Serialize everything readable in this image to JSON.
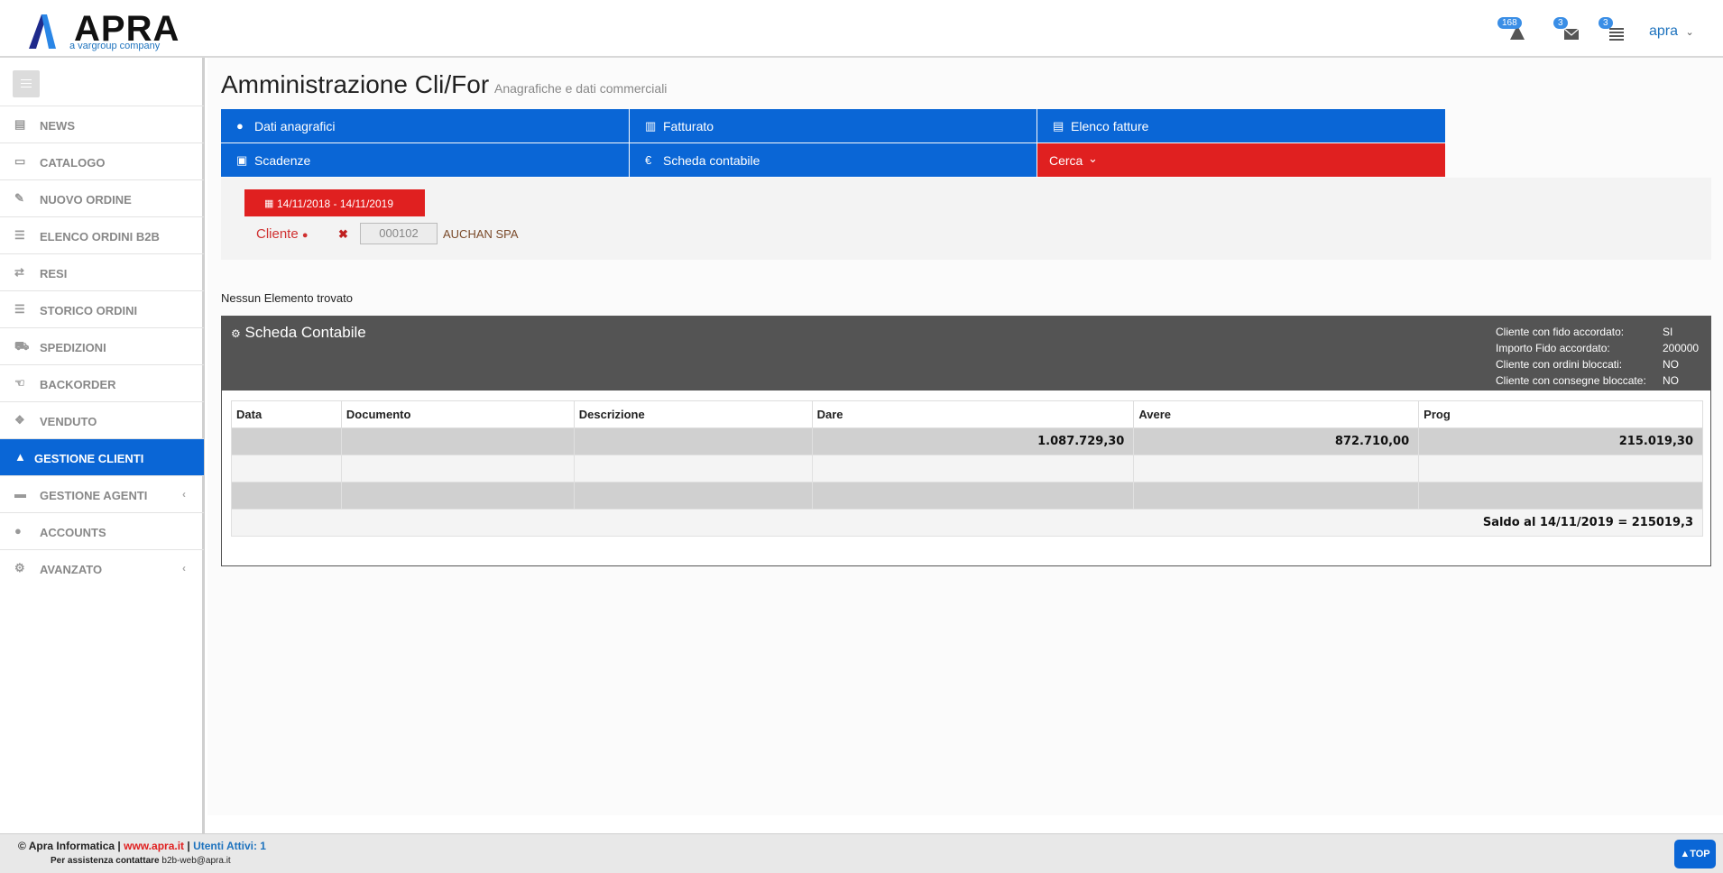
{
  "header": {
    "logo_text": "APRA",
    "logo_sub": "a vargroup company",
    "notifications": [
      {
        "icon": "warning-icon",
        "count": "168"
      },
      {
        "icon": "mail-icon",
        "count": "3"
      },
      {
        "icon": "list-icon",
        "count": "3"
      }
    ],
    "user_label": "apra"
  },
  "sidebar": {
    "items": [
      {
        "label": "NEWS",
        "icon": "newspaper-icon",
        "glyph": "▤",
        "active": false,
        "chevron": ""
      },
      {
        "label": "CATALOGO",
        "icon": "catalog-icon",
        "glyph": "▭",
        "active": false,
        "chevron": ""
      },
      {
        "label": "NUOVO ORDINE",
        "icon": "pencil-icon",
        "glyph": "✎",
        "active": false,
        "chevron": ""
      },
      {
        "label": "ELENCO ORDINI B2B",
        "icon": "list-icon",
        "glyph": "☰",
        "active": false,
        "chevron": ""
      },
      {
        "label": "RESI",
        "icon": "exchange-icon",
        "glyph": "⇄",
        "active": false,
        "chevron": ""
      },
      {
        "label": "STORICO ORDINI",
        "icon": "list-icon",
        "glyph": "☰",
        "active": false,
        "chevron": ""
      },
      {
        "label": "SPEDIZIONI",
        "icon": "truck-icon",
        "glyph": "⛟",
        "active": false,
        "chevron": ""
      },
      {
        "label": "BACKORDER",
        "icon": "hand-icon",
        "glyph": "☜",
        "active": false,
        "chevron": ""
      },
      {
        "label": "VENDUTO",
        "icon": "dropbox-icon",
        "glyph": "❖",
        "active": false,
        "chevron": ""
      },
      {
        "label": "GESTIONE CLIENTI",
        "icon": "bell-icon",
        "glyph": "▲",
        "active": true,
        "chevron": ""
      },
      {
        "label": "GESTIONE AGENTI",
        "icon": "briefcase-icon",
        "glyph": "▬",
        "active": false,
        "chevron": "‹"
      },
      {
        "label": "ACCOUNTS",
        "icon": "users-icon",
        "glyph": "●",
        "active": false,
        "chevron": ""
      },
      {
        "label": "AVANZATO",
        "icon": "gears-icon",
        "glyph": "⚙",
        "active": false,
        "chevron": "‹"
      }
    ]
  },
  "page": {
    "title": "Amministrazione Cli/For",
    "subtitle": "Anagrafiche e dati commerciali"
  },
  "tabs": [
    {
      "label": "Dati anagrafici",
      "icon": "user-icon",
      "glyph": "●",
      "color": "#0a66d6"
    },
    {
      "label": "Fatturato",
      "icon": "bar-chart-icon",
      "glyph": "▥",
      "color": "#0a66d6"
    },
    {
      "label": "Elenco fatture",
      "icon": "list-icon",
      "glyph": "▤",
      "color": "#0a66d6"
    },
    {
      "label": "Scadenze",
      "icon": "calendar-x-icon",
      "glyph": "▣",
      "color": "#0a66d6"
    },
    {
      "label": "Scheda contabile",
      "icon": "euro-icon",
      "glyph": "€",
      "color": "#0a66d6"
    },
    {
      "label": "Cerca",
      "icon": "chevron-down-icon",
      "glyph": "⌄",
      "color": "#e02020"
    }
  ],
  "filter": {
    "date_range": "14/11/2018 - 14/11/2019",
    "cliente_label": "Cliente",
    "remove_glyph": "✖",
    "cliente_code": "000102",
    "cliente_name": "AUCHAN SPA"
  },
  "no_items_text": "Nessun Elemento trovato",
  "scheda": {
    "title": "Scheda Contabile",
    "info": [
      {
        "key": "Cliente con fido accordato:",
        "value": "SI"
      },
      {
        "key": "Importo Fido accordato:",
        "value": "200000"
      },
      {
        "key": "Cliente con ordini bloccati:",
        "value": "NO"
      },
      {
        "key": "Cliente con consegne bloccate:",
        "value": "NO"
      }
    ],
    "columns": [
      "Data",
      "Documento",
      "Descrizione",
      "Dare",
      "Avere",
      "Prog"
    ],
    "rows": [
      [
        "",
        "",
        "",
        "1.087.729,30",
        "872.710,00",
        "215.019,30"
      ],
      [
        "",
        "",
        "",
        "",
        "",
        ""
      ],
      [
        "",
        "",
        "",
        "",
        "",
        ""
      ]
    ],
    "saldo": "Saldo al 14/11/2019 = 215019,3"
  },
  "footer": {
    "copyright": "© Apra Informatica |",
    "site": "www.apra.it",
    "sep": "|",
    "users": "Utenti Attivi: 1",
    "support_prefix": "Per assistenza contattare",
    "support_email": "b2b-web@apra.it",
    "top_label": "TOP"
  }
}
